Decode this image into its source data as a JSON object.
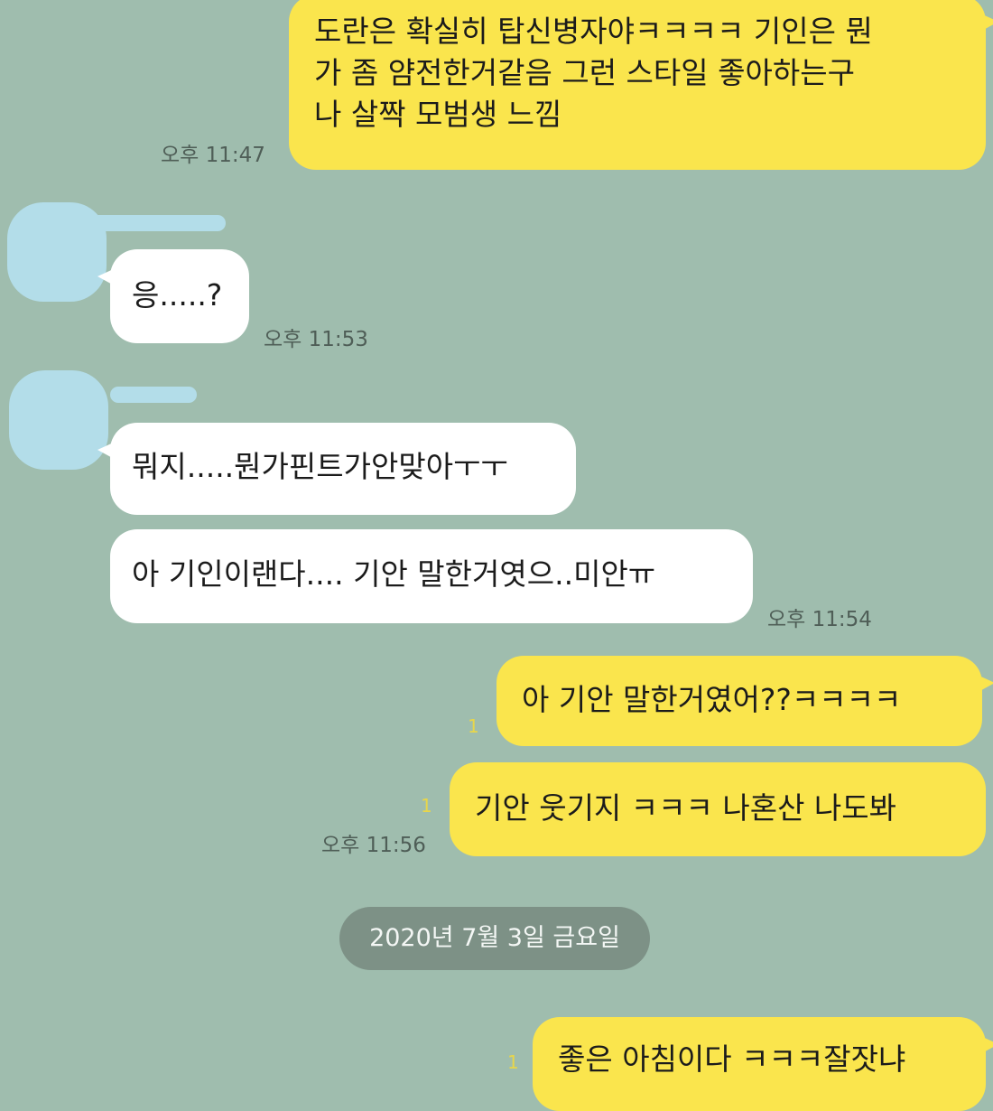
{
  "chat": {
    "messages": [
      {
        "sender": "me",
        "lines": [
          "도란은 확실히 탑신병자야ㅋㅋㅋㅋ 기인은 뭔",
          "가 좀 얌전한거같음 그런 스타일 좋아하는구",
          "나 살짝 모범생 느낌"
        ],
        "time": "오후 11:47"
      },
      {
        "sender": "other",
        "text": "응.....?",
        "time": "오후 11:53"
      },
      {
        "sender": "other",
        "text": "뭐지.....뭔가핀트가안맞아ㅜㅜ"
      },
      {
        "sender": "other",
        "text": "아 기인이랜다.... 기안 말한거엿으..미안ㅠ",
        "time": "오후 11:54"
      },
      {
        "sender": "me",
        "text": "아 기안 말한거였어??ㅋㅋㅋㅋ",
        "read_count": "1"
      },
      {
        "sender": "me",
        "text": "기안 웃기지 ㅋㅋㅋ 나혼산 나도봐",
        "read_count": "1",
        "time": "오후 11:56"
      },
      {
        "sender": "me",
        "text": "좋은 아침이다 ㅋㅋㅋ잘잣냐",
        "read_count": "1"
      }
    ],
    "date_divider": "2020년 7월 3일 금요일"
  },
  "colors": {
    "background": "#9fbdae",
    "my_bubble": "#fae54d",
    "other_bubble": "#ffffff",
    "date_pill": "#7d9186",
    "avatar_blur": "#b3dde9"
  },
  "icons": [
    "avatar-placeholder",
    "avatar-placeholder"
  ]
}
